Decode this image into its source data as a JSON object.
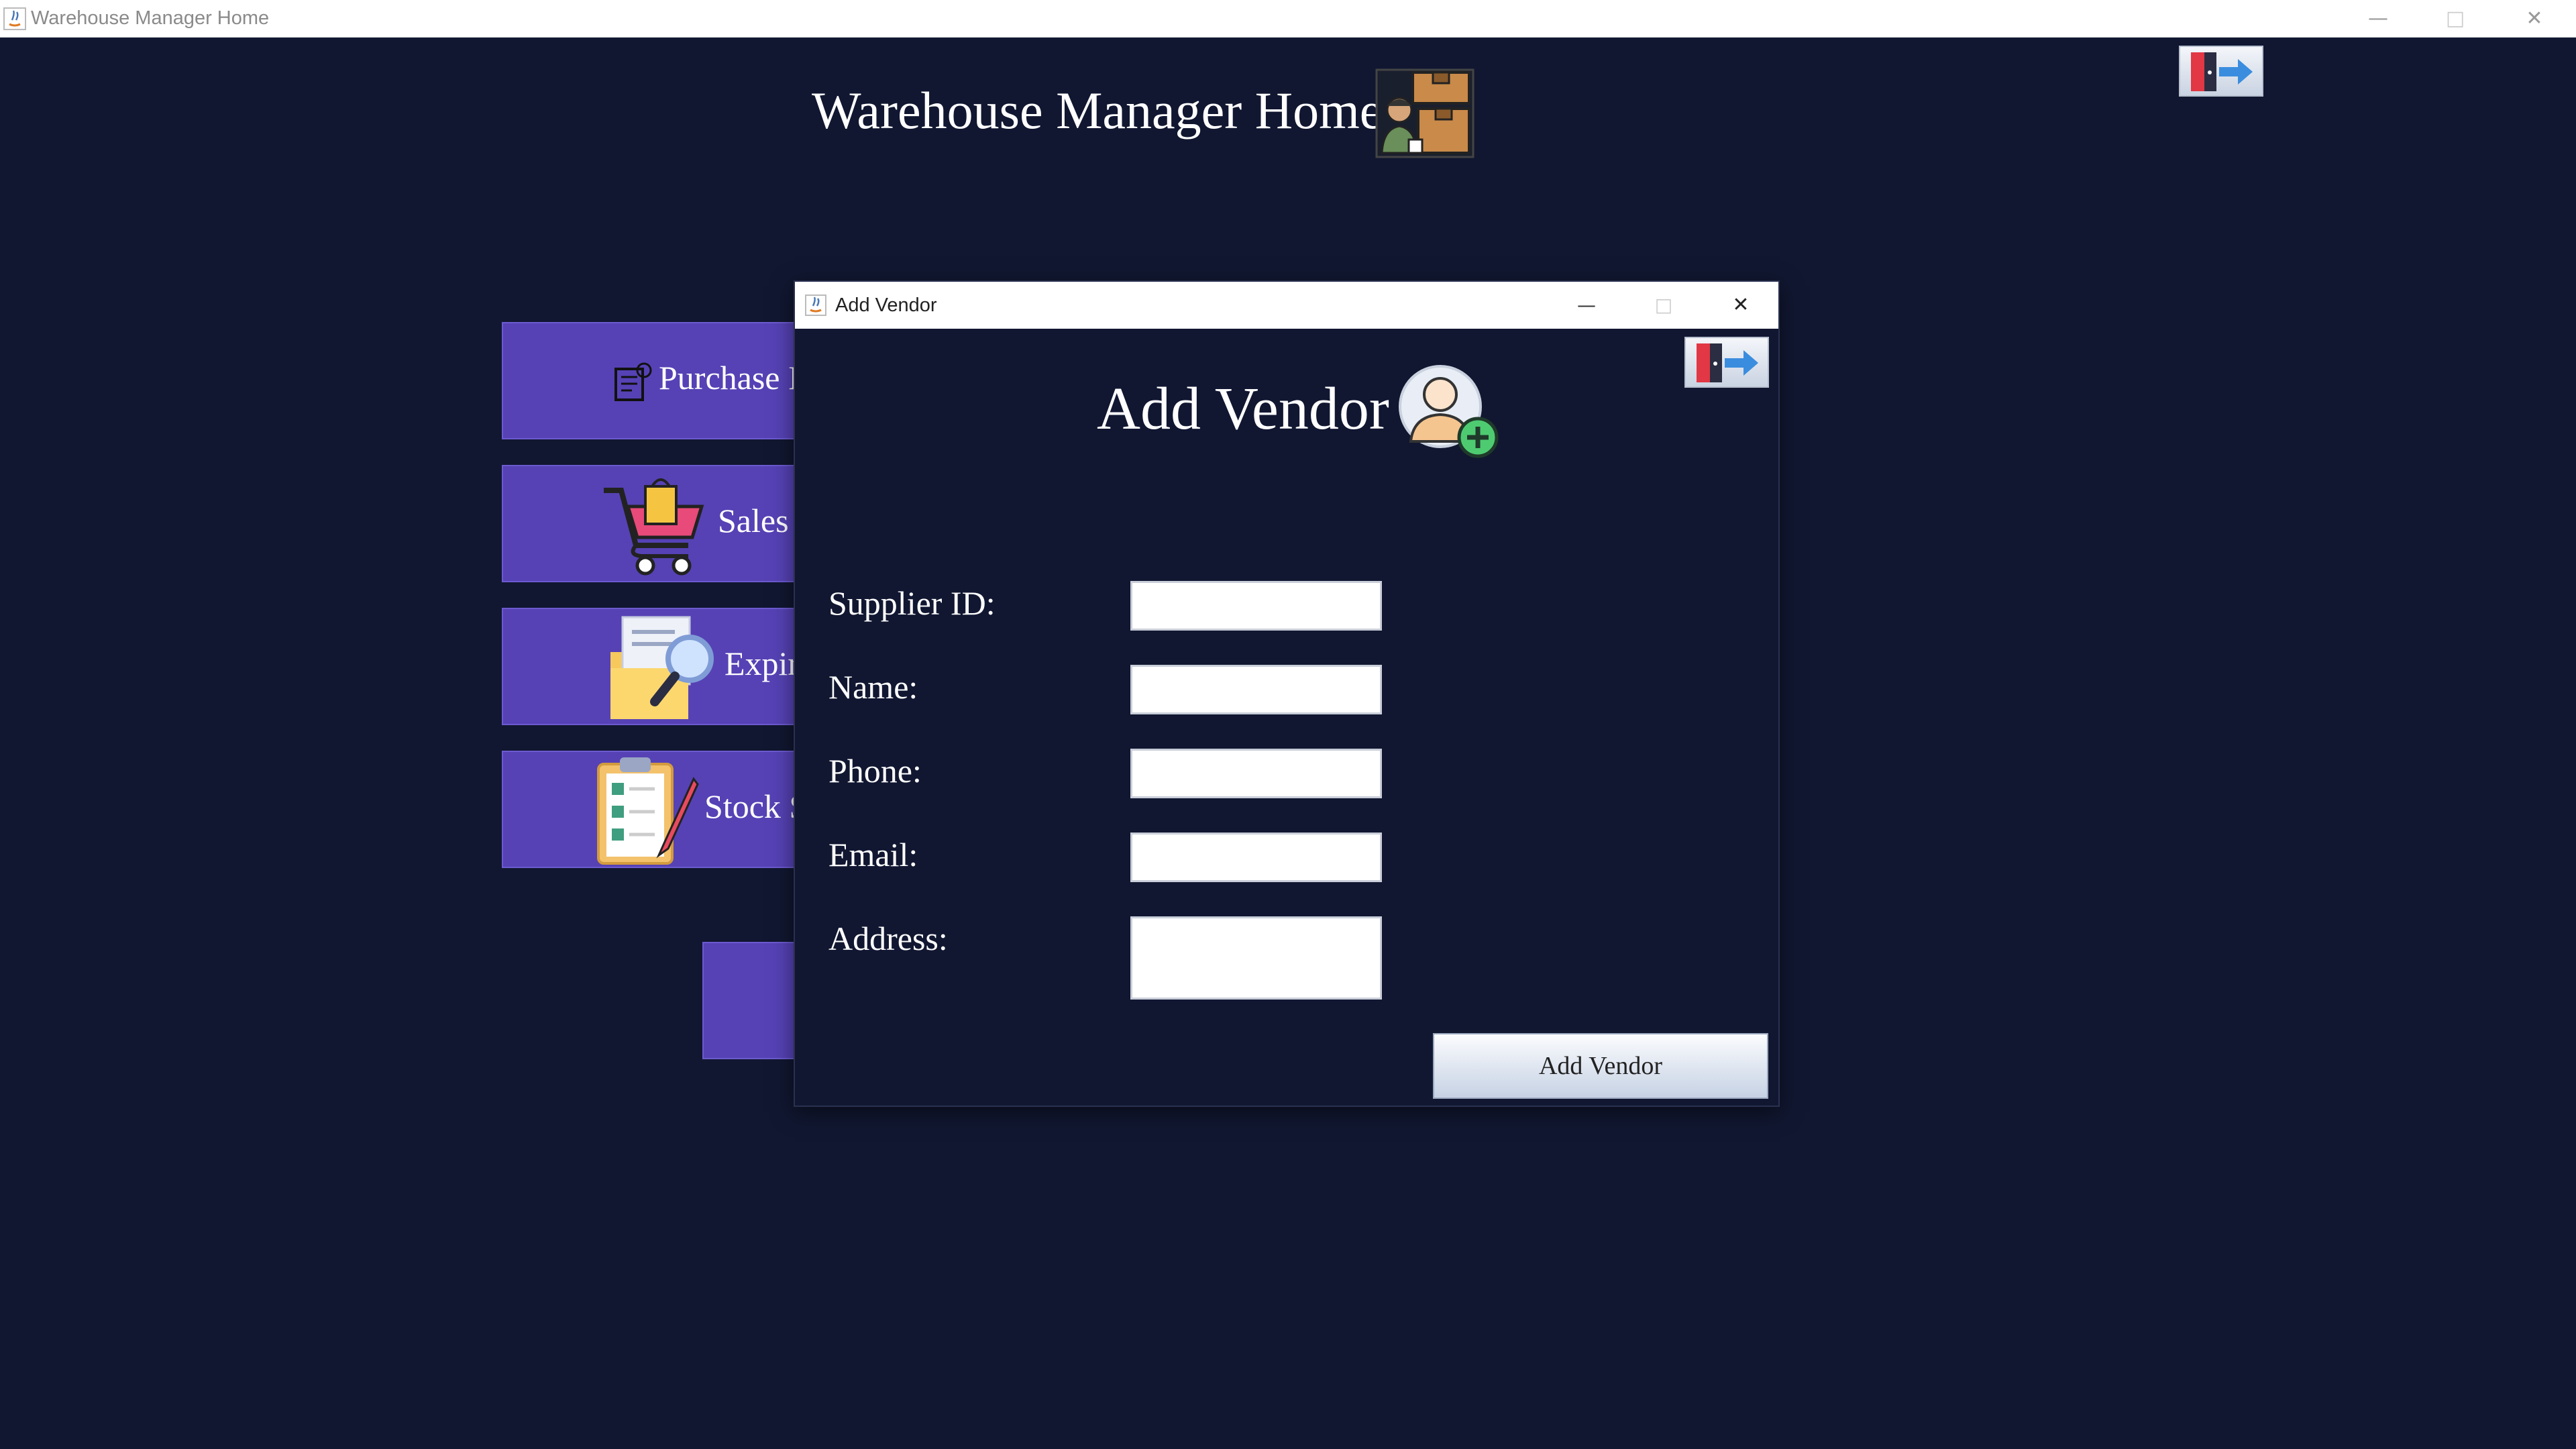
{
  "main_window": {
    "title": "Warehouse Manager Home",
    "minimize": "—",
    "maximize": "□",
    "close": "✕"
  },
  "header": {
    "title": "Warehouse Manager Home",
    "icon": "warehouse-manager-icon",
    "exit_icon": "exit-door-icon"
  },
  "menu": {
    "items": [
      {
        "label": "Purchase I",
        "icon": "purchase-order-icon"
      },
      {
        "label": "Sales",
        "icon": "shopping-cart-icon"
      },
      {
        "label": "Expir",
        "icon": "folder-search-icon"
      },
      {
        "label": "Stock S",
        "icon": "clipboard-checklist-icon"
      }
    ]
  },
  "dialog": {
    "title": "Add Vendor",
    "minimize": "—",
    "maximize": "□",
    "close": "✕",
    "heading": "Add Vendor",
    "heading_icon": "add-user-icon",
    "exit_icon": "exit-door-icon",
    "fields": [
      {
        "label": "Supplier ID:",
        "value": ""
      },
      {
        "label": "Name:",
        "value": ""
      },
      {
        "label": "Phone:",
        "value": ""
      },
      {
        "label": "Email:",
        "value": ""
      },
      {
        "label": "Address:",
        "value": ""
      }
    ],
    "submit_label": "Add Vendor"
  },
  "colors": {
    "background": "#111731",
    "menu_button": "#5642b5",
    "titlebar": "#ffffff"
  }
}
